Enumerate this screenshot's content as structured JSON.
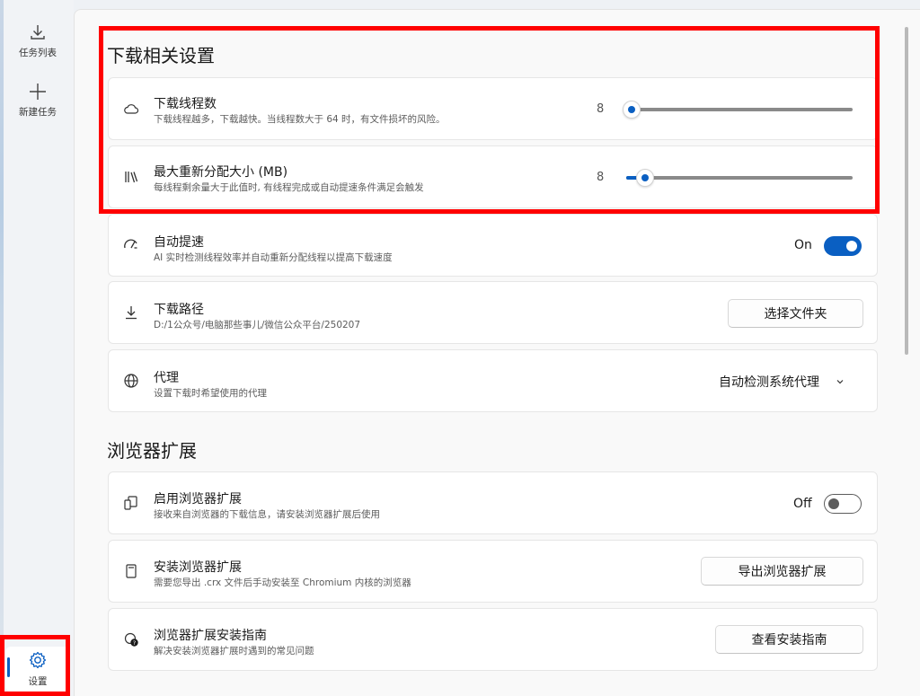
{
  "nav": {
    "tasks_label": "任务列表",
    "new_task_label": "新建任务",
    "settings_label": "设置"
  },
  "sections": {
    "download": "下载相关设置",
    "browser": "浏览器扩展"
  },
  "settings": {
    "threads": {
      "title": "下载线程数",
      "desc": "下载线程越多，下载越快。当线程数大于 64 时，有文件损坏的风险。",
      "value": "8",
      "fraction": 0.0
    },
    "realloc": {
      "title": "最大重新分配大小 (MB)",
      "desc": "每线程剩余量大于此值时, 有线程完成或自动提速条件满足会触发",
      "value": "8",
      "fraction": 0.06
    },
    "auto_speed": {
      "title": "自动提速",
      "desc": "AI 实时检测线程效率并自动重新分配线程以提高下载速度",
      "state": "On"
    },
    "path": {
      "title": "下载路径",
      "desc": "D:/1公众号/电脑那些事儿/微信公众平台/250207",
      "button": "选择文件夹"
    },
    "proxy": {
      "title": "代理",
      "desc": "设置下载时希望使用的代理",
      "selected": "自动检测系统代理"
    },
    "enable_ext": {
      "title": "启用浏览器扩展",
      "desc": "接收来自浏览器的下载信息，请安装浏览器扩展后使用",
      "state": "Off"
    },
    "install_ext": {
      "title": "安装浏览器扩展",
      "desc": "需要您导出 .crx 文件后手动安装至 Chromium 内核的浏览器",
      "button": "导出浏览器扩展"
    },
    "guide": {
      "title": "浏览器扩展安装指南",
      "desc": "解决安装浏览器扩展时遇到的常见问题",
      "button": "查看安装指南"
    }
  },
  "colors": {
    "accent": "#0a5fc2",
    "highlight": "#ff0000"
  }
}
